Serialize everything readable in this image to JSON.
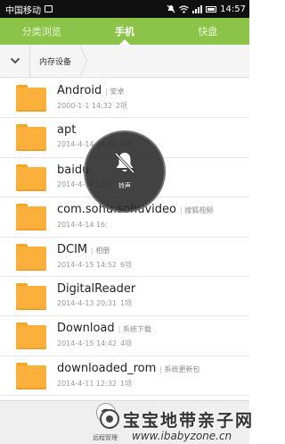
{
  "status_bar": {
    "carrier": "中国移动",
    "time": "14:57"
  },
  "tabs": [
    {
      "label": "分类浏览",
      "active": false
    },
    {
      "label": "手机",
      "active": true
    },
    {
      "label": "快盘",
      "active": false
    }
  ],
  "breadcrumb": {
    "current": "内存设备"
  },
  "files": [
    {
      "name": "Android",
      "alias": "安卓",
      "date": "2000-1-1 14:32",
      "count": "2项"
    },
    {
      "name": "apt",
      "alias": "",
      "date": "2014-4-14 14:54",
      "count": "1项"
    },
    {
      "name": "baidu",
      "alias": "",
      "date": "2014-4-14 17:4",
      "count": ""
    },
    {
      "name": "com.sohu.sohuvideo",
      "alias": "搜狐视频",
      "date": "2014-4-14 16:",
      "count": ""
    },
    {
      "name": "DCIM",
      "alias": "相册",
      "date": "2014-4-15 14:52",
      "count": "6项"
    },
    {
      "name": "DigitalReader",
      "alias": "",
      "date": "2014-4-13 20:31",
      "count": "1项"
    },
    {
      "name": "Download",
      "alias": "系统下载",
      "date": "2014-4-15 14:42",
      "count": "4项"
    },
    {
      "name": "downloaded_rom",
      "alias": "系统更新包",
      "date": "2014-4-11 12:32",
      "count": "1项"
    }
  ],
  "mute_overlay": {
    "label": "铃声",
    "icon": "bell-muted-icon"
  },
  "bottom_bar": {
    "remote_label": "远程管理"
  },
  "watermark": {
    "cn": "宝宝地带亲子网",
    "en": "www.ibabyzone.cn"
  },
  "colors": {
    "tab_bar": "#8cc349",
    "folder": "#fbb03b"
  }
}
